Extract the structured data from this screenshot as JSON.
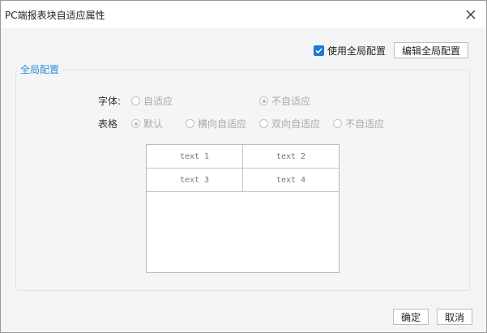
{
  "window": {
    "title": "PC端报表块自适应属性",
    "close_icon": "close-icon"
  },
  "global": {
    "use_global_label": "使用全局配置",
    "use_global_checked": true,
    "edit_button_label": "编辑全局配置"
  },
  "config": {
    "legend": "全局配置",
    "font": {
      "label": "字体:",
      "options": [
        "自适应",
        "不自适应"
      ],
      "selected": "不自适应"
    },
    "table": {
      "label": "表格",
      "options": [
        "默认",
        "横向自适应",
        "双向自适应",
        "不自适应"
      ],
      "selected": "默认"
    },
    "preview_cells": [
      "text 1",
      "text 2",
      "text 3",
      "text 4"
    ]
  },
  "footer": {
    "ok_label": "确定",
    "cancel_label": "取消"
  },
  "colors": {
    "accent": "#1a7ad8",
    "legend": "#2a91d6",
    "disabled_text": "#a8a8a8"
  }
}
